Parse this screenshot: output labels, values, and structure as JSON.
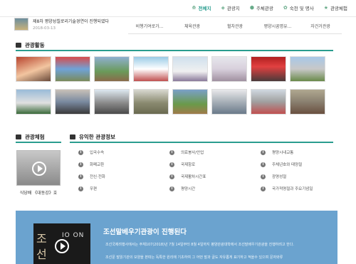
{
  "top_nav": [
    {
      "icon": "home-icon",
      "glyph": "⟰",
      "label": "전체지",
      "active": true
    },
    {
      "icon": "diamond-icon",
      "glyph": "◈",
      "label": "관광지",
      "active": false
    },
    {
      "icon": "pin-icon",
      "glyph": "⬢",
      "label": "주체관광",
      "active": false
    },
    {
      "icon": "lock-icon",
      "glyph": "✿",
      "label": "숙천 및 명사",
      "active": false
    },
    {
      "icon": "star-icon",
      "glyph": "★",
      "label": "관광체험",
      "active": false
    }
  ],
  "news": {
    "title": "제8차 평양성칠로리기술경연이 진행되였다",
    "date": "2018-03-13"
  },
  "tabs": [
    "비행기여로가...",
    "체육관광",
    "혈차관광",
    "평양시꿈명유...",
    "자건거관광"
  ],
  "sections": {
    "gallery_title": "관광활동",
    "video_title": "관광체험",
    "info_title": "유익한 관광정보"
  },
  "video": {
    "caption": "식당배 《대동강》호"
  },
  "info_items": [
    [
      "입국수속",
      "의료봉사/안업",
      "평양시내교통"
    ],
    [
      "화폐교환",
      "국제항로",
      "주체년호와 태양절"
    ],
    [
      "전신·전화",
      "국제활차시간표",
      "광명성절"
    ],
    [
      "우편",
      "평양시간",
      "국가적명절과 주요기념일"
    ]
  ],
  "banner": {
    "title": "조선말베우기관광이 진행된다",
    "line1": "조선국제려행사에서는 주체107(2018)년 7월 14일부터 8월 4일까지 평양관광대학에서 조선말배우기관광을 진행하려고 한다.",
    "line2": "조선문 말읽기관의 모양을 본따는 독특한 원리에 기초하여 그 어떤 말과 글도 자유롭게 표기하고 적을수 있으며 문자와류",
    "thumb_text_1": "조",
    "thumb_text_2": "선",
    "thumb_text_3": "IO ON"
  }
}
